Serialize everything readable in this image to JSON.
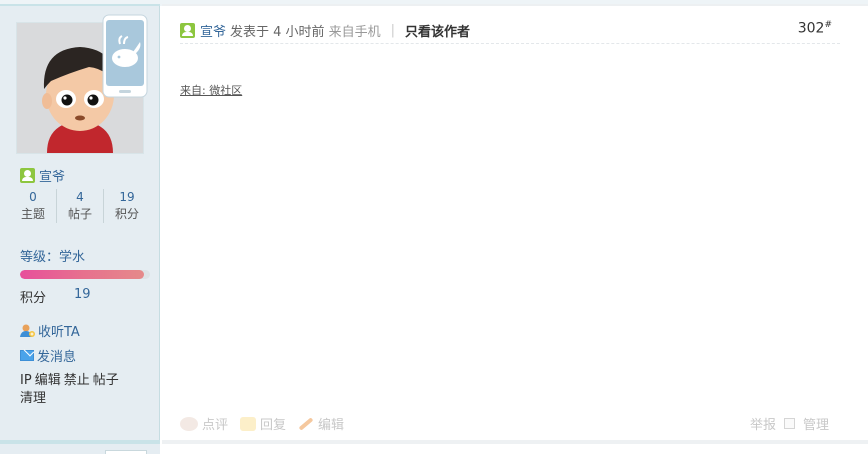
{
  "sidebar": {
    "username": "宣爷",
    "stats": [
      {
        "value": "0",
        "label": "主题"
      },
      {
        "value": "4",
        "label": "帖子"
      },
      {
        "value": "19",
        "label": "积分"
      }
    ],
    "level_label": "等级：学水",
    "level_progress": 0.95,
    "score_label": "积分",
    "score_value": "19",
    "follow_label": "收听TA",
    "message_label": "发消息",
    "admin_links": [
      "IP",
      "编辑",
      "禁止",
      "帖子",
      "清理"
    ]
  },
  "post": {
    "author": "宣爷",
    "posted_text": "发表于 4 小时前",
    "from_mobile": "来自手机",
    "separator": "|",
    "only_author": "只看该作者",
    "floor_number": "302",
    "floor_mark": "#",
    "source_link": "来自: 微社区",
    "actions": [
      {
        "icon": "comment-icon",
        "label": "点评"
      },
      {
        "icon": "reply-icon",
        "label": "回复"
      },
      {
        "icon": "edit-icon",
        "label": "编辑"
      }
    ],
    "report_label": "举报",
    "manage_label": "管理"
  },
  "colors": {
    "link": "#336699",
    "sidebar_bg": "#e5edf2",
    "accent_green": "#8dc63f",
    "level_bar_start": "#e74f9b",
    "disabled_text": "#c8c8c8"
  }
}
